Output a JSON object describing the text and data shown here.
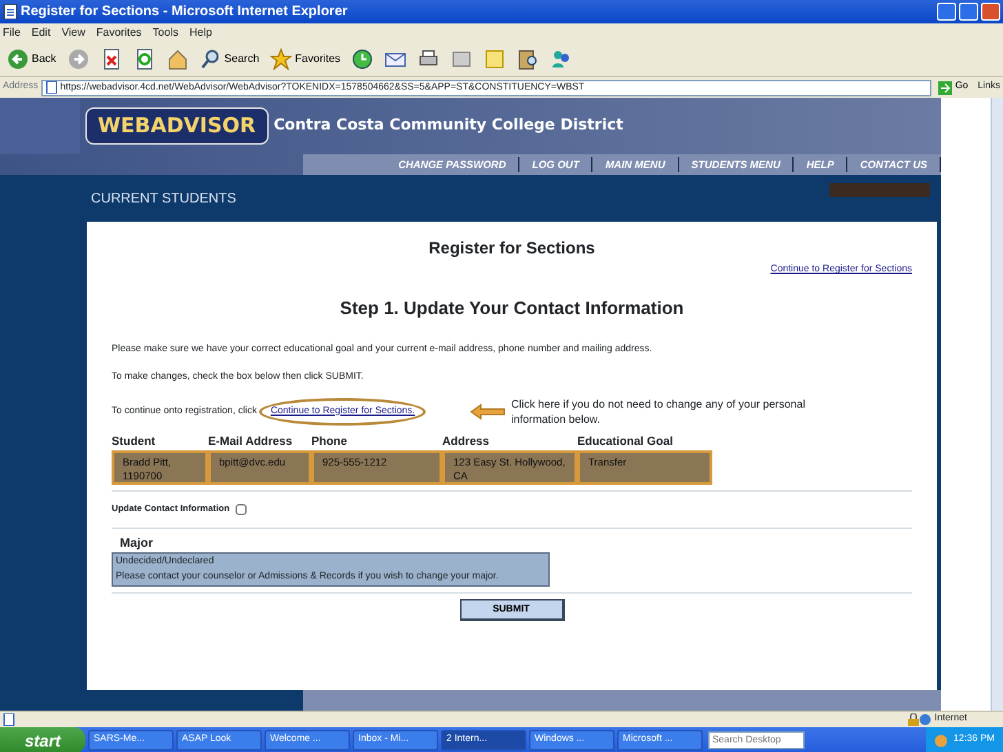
{
  "window": {
    "title": "Register for Sections - Microsoft Internet Explorer"
  },
  "menu": [
    "File",
    "Edit",
    "View",
    "Favorites",
    "Tools",
    "Help"
  ],
  "toolbar": [
    {
      "kind": "back",
      "label": "Back"
    },
    {
      "kind": "forward"
    },
    {
      "kind": "stop"
    },
    {
      "kind": "refresh"
    },
    {
      "kind": "home"
    },
    {
      "kind": "search",
      "label": "Search"
    },
    {
      "kind": "favorites",
      "label": "Favorites"
    },
    {
      "kind": "history"
    },
    {
      "kind": "mail"
    },
    {
      "kind": "print"
    },
    {
      "kind": "edit"
    },
    {
      "kind": "note"
    },
    {
      "kind": "research"
    },
    {
      "kind": "messenger"
    }
  ],
  "address_bar": {
    "label": "Address",
    "url": "https://webadvisor.4cd.net/WebAdvisor/WebAdvisor?TOKENIDX=1578504662&SS=5&APP=ST&CONSTITUENCY=WBST",
    "go": "Go",
    "links": "Links"
  },
  "header": {
    "logo": "WEBADVISOR",
    "district": "Contra Costa Community College District",
    "nav": [
      "CHANGE PASSWORD",
      "LOG OUT",
      "MAIN MENU",
      "STUDENTS MENU",
      "HELP",
      "CONTACT US"
    ],
    "section": "CURRENT STUDENTS"
  },
  "content": {
    "title": "Register for Sections",
    "top_link": "Continue to Register for Sections",
    "step": "Step 1. Update Your Contact Information",
    "lines": [
      "Please make sure we have your correct educational goal and your current e-mail address, phone number and mailing address.",
      "To make changes, check the box below then click SUBMIT."
    ],
    "continue_text": "To continue onto registration, click",
    "continue_link": "Continue to Register for Sections.",
    "callout": "Click here if you do not need to change any of your personal information below.",
    "contact_columns": [
      "Student",
      "E-Mail Address",
      "Phone",
      "Address",
      "Educational Goal"
    ],
    "contact_values": [
      "Bradd Pitt, 1190700",
      "bpitt@dvc.edu",
      "925-555-1212",
      "123 Easy St. Hollywood, CA",
      "Transfer"
    ],
    "update_label": "Update Contact Information",
    "update_checked": false,
    "major_label": "Major",
    "major_value": "Undecided/Undeclared",
    "major_note": "Please contact your counselor or Admissions & Records if you wish to change your major.",
    "submit": "SUBMIT"
  },
  "status_bar": {
    "zone": "Internet"
  },
  "taskbar": {
    "start": "start",
    "items": [
      {
        "label": "SARS-Me...",
        "selected": false
      },
      {
        "label": "ASAP Look",
        "selected": false
      },
      {
        "label": "Welcome ...",
        "selected": false
      },
      {
        "label": "Inbox - Mi...",
        "selected": false
      },
      {
        "label": "2 Intern...",
        "selected": true
      },
      {
        "label": "Windows ...",
        "selected": false
      },
      {
        "label": "Microsoft ...",
        "selected": false
      }
    ],
    "search_placeholder": "Search Desktop",
    "time": "12:36 PM"
  }
}
